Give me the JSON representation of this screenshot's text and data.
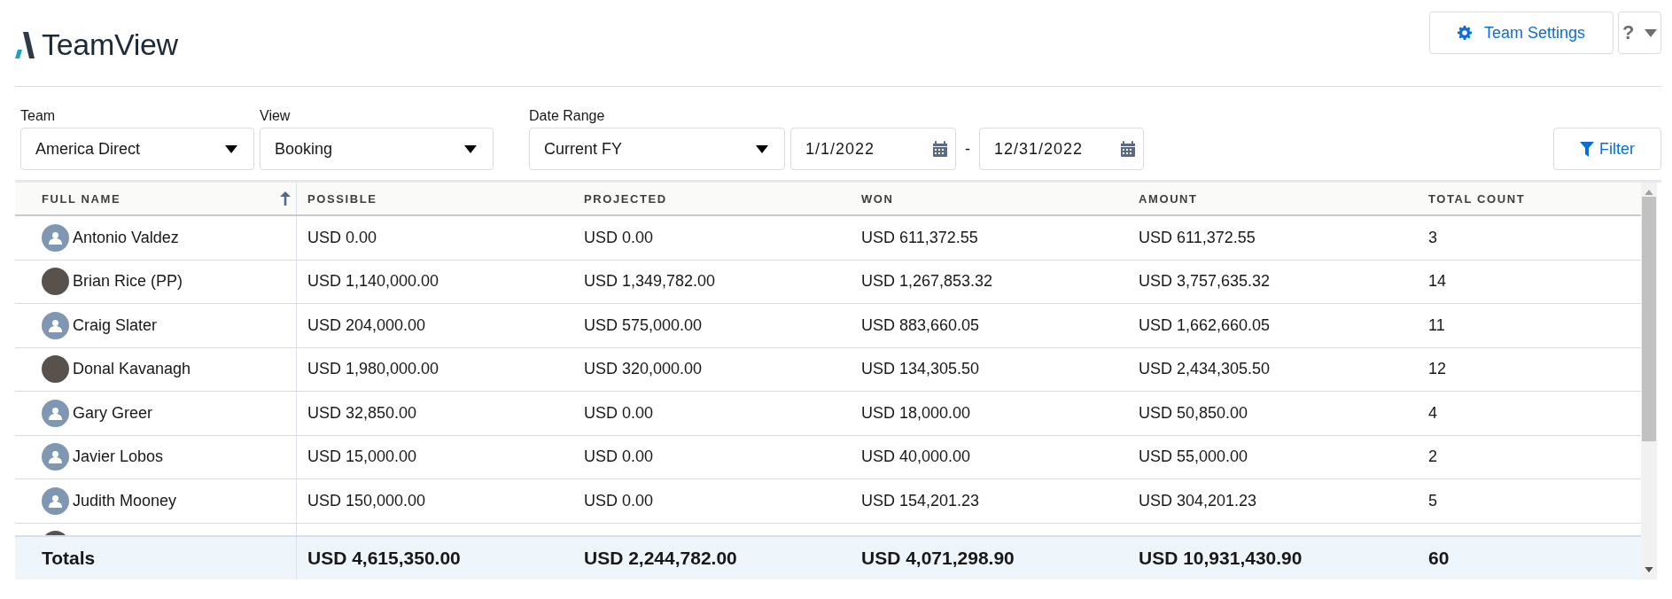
{
  "app": {
    "title": "TeamView"
  },
  "header_buttons": {
    "settings": "Team Settings",
    "help": "?"
  },
  "filters": [
    {
      "kind": "dropdown",
      "label": "Team",
      "value": "America Direct"
    },
    {
      "kind": "dropdown",
      "label": "View",
      "value": "Booking"
    },
    {
      "kind": "daterange",
      "label": "Date Range",
      "value": "Current FY",
      "start": "1/1/2022",
      "separator": "-",
      "end": "12/31/2022"
    }
  ],
  "filter_button": "Filter",
  "table": {
    "columns": [
      {
        "label": "FULL NAME",
        "sorted": true
      },
      {
        "label": "POSSIBLE",
        "sorted": false
      },
      {
        "label": "PROJECTED",
        "sorted": false
      },
      {
        "label": "WON",
        "sorted": false
      },
      {
        "label": "AMOUNT",
        "sorted": false
      },
      {
        "label": "TOTAL COUNT",
        "sorted": false
      }
    ],
    "rows": [
      {
        "kind": "placeholder",
        "cells": [
          "Antonio Valdez",
          "USD 0.00",
          "USD 0.00",
          "USD 611,372.55",
          "USD 611,372.55",
          "3"
        ]
      },
      {
        "kind": "photo",
        "cells": [
          "Brian Rice (PP)",
          "USD 1,140,000.00",
          "USD 1,349,782.00",
          "USD 1,267,853.32",
          "USD 3,757,635.32",
          "14"
        ]
      },
      {
        "kind": "placeholder",
        "cells": [
          "Craig Slater",
          "USD 204,000.00",
          "USD 575,000.00",
          "USD 883,660.05",
          "USD 1,662,660.05",
          "11"
        ]
      },
      {
        "kind": "photo",
        "cells": [
          "Donal Kavanagh",
          "USD 1,980,000.00",
          "USD 320,000.00",
          "USD 134,305.50",
          "USD 2,434,305.50",
          "12"
        ]
      },
      {
        "kind": "placeholder",
        "cells": [
          "Gary Greer",
          "USD 32,850.00",
          "USD 0.00",
          "USD 18,000.00",
          "USD 50,850.00",
          "4"
        ]
      },
      {
        "kind": "placeholder",
        "cells": [
          "Javier Lobos",
          "USD 15,000.00",
          "USD 0.00",
          "USD 40,000.00",
          "USD 55,000.00",
          "2"
        ]
      },
      {
        "kind": "placeholder",
        "cells": [
          "Judith Mooney",
          "USD 150,000.00",
          "USD 0.00",
          "USD 154,201.23",
          "USD 304,201.23",
          "5"
        ]
      },
      {
        "kind": "photo",
        "cells": []
      }
    ],
    "totals": [
      "Totals",
      "USD 4,615,350.00",
      "USD 2,244,782.00",
      "USD 4,071,298.90",
      "USD 10,931,430.90",
      "60"
    ]
  }
}
